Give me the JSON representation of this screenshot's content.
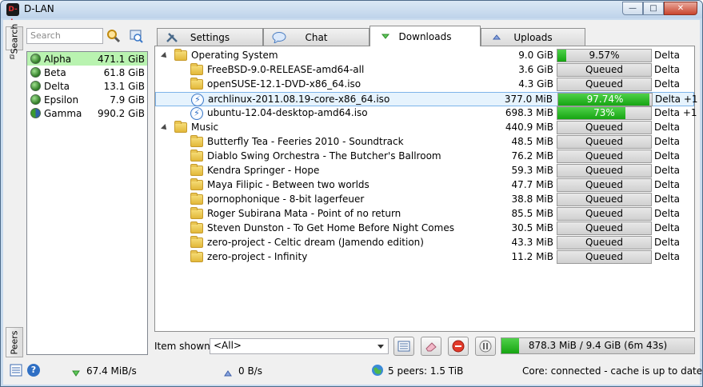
{
  "window": {
    "title": "D-LAN",
    "icon_text": "D-L",
    "minimize": "—",
    "maximize": "□",
    "close": "✕"
  },
  "dock": {
    "search_tab": "Search",
    "peers_tab": "Peers",
    "float_icon": "⧉"
  },
  "search": {
    "placeholder": "Search"
  },
  "toolbar_icons": [
    "search-icon",
    "browse-icon"
  ],
  "peers": [
    {
      "name": "Alpha",
      "size": "471.1 GiB"
    },
    {
      "name": "Beta",
      "size": "61.8 GiB"
    },
    {
      "name": "Delta",
      "size": "13.1 GiB"
    },
    {
      "name": "Epsilon",
      "size": "7.9 GiB"
    },
    {
      "name": "Gamma",
      "size": "990.2 GiB"
    }
  ],
  "tabs": {
    "settings": "Settings",
    "chat": "Chat",
    "downloads": "Downloads",
    "uploads": "Uploads"
  },
  "downloads": [
    {
      "name": "Operating System",
      "size": "9.0 GiB",
      "status": "9.57%",
      "progress": 0.0957,
      "peer": "Delta",
      "type": "folder",
      "level": 0,
      "expanded": true
    },
    {
      "name": "FreeBSD-9.0-RELEASE-amd64-all",
      "size": "3.6 GiB",
      "status": "Queued",
      "progress": 0,
      "peer": "Delta",
      "type": "folder",
      "level": 1
    },
    {
      "name": "openSUSE-12.1-DVD-x86_64.iso",
      "size": "4.3 GiB",
      "status": "Queued",
      "progress": 0,
      "peer": "Delta",
      "type": "folder",
      "level": 1
    },
    {
      "name": "archlinux-2011.08.19-core-x86_64.iso",
      "size": "377.0 MiB",
      "status": "97.74%",
      "progress": 0.9774,
      "peer": "Delta +1",
      "type": "file",
      "level": 1,
      "highlight": true
    },
    {
      "name": "ubuntu-12.04-desktop-amd64.iso",
      "size": "698.3 MiB",
      "status": "73%",
      "progress": 0.73,
      "peer": "Delta +1",
      "type": "file",
      "level": 1
    },
    {
      "name": "Music",
      "size": "440.9 MiB",
      "status": "Queued",
      "progress": 0,
      "peer": "Delta",
      "type": "folder",
      "level": 0,
      "expanded": true
    },
    {
      "name": "Butterfly Tea - Feeries 2010 - Soundtrack",
      "size": "48.5 MiB",
      "status": "Queued",
      "progress": 0,
      "peer": "Delta",
      "type": "folder",
      "level": 1
    },
    {
      "name": "Diablo Swing Orchestra - The Butcher's Ballroom",
      "size": "76.2 MiB",
      "status": "Queued",
      "progress": 0,
      "peer": "Delta",
      "type": "folder",
      "level": 1
    },
    {
      "name": "Kendra Springer - Hope",
      "size": "59.3 MiB",
      "status": "Queued",
      "progress": 0,
      "peer": "Delta",
      "type": "folder",
      "level": 1
    },
    {
      "name": "Maya Filipic - Between two worlds",
      "size": "47.7 MiB",
      "status": "Queued",
      "progress": 0,
      "peer": "Delta",
      "type": "folder",
      "level": 1
    },
    {
      "name": "pornophonique - 8-bit lagerfeuer",
      "size": "38.8 MiB",
      "status": "Queued",
      "progress": 0,
      "peer": "Delta",
      "type": "folder",
      "level": 1
    },
    {
      "name": "Roger Subirana Mata - Point of no return",
      "size": "85.5 MiB",
      "status": "Queued",
      "progress": 0,
      "peer": "Delta",
      "type": "folder",
      "level": 1
    },
    {
      "name": "Steven Dunston - To Get Home Before Night Comes",
      "size": "30.5 MiB",
      "status": "Queued",
      "progress": 0,
      "peer": "Delta",
      "type": "folder",
      "level": 1
    },
    {
      "name": "zero-project - Celtic dream (Jamendo edition)",
      "size": "43.3 MiB",
      "status": "Queued",
      "progress": 0,
      "peer": "Delta",
      "type": "folder",
      "level": 1
    },
    {
      "name": "zero-project - Infinity",
      "size": "11.2 MiB",
      "status": "Queued",
      "progress": 0,
      "peer": "Delta",
      "type": "folder",
      "level": 1
    }
  ],
  "controls": {
    "item_shown_label": "Item shown :",
    "item_shown_value": "<All>",
    "total_progress_text": "878.3 MiB / 9.4 GiB (6m 43s)",
    "total_progress": 0.09
  },
  "status": {
    "download_rate": "67.4 MiB/s",
    "upload_rate": "0 B/s",
    "peers": "5 peers: 1.5 TiB",
    "core": "Core: connected - cache is up to date",
    "help": "?"
  },
  "colors": {
    "progress_green": "#16a412",
    "selection_green": "#b9f3b0",
    "highlight_blue": "#e6f3fd"
  }
}
